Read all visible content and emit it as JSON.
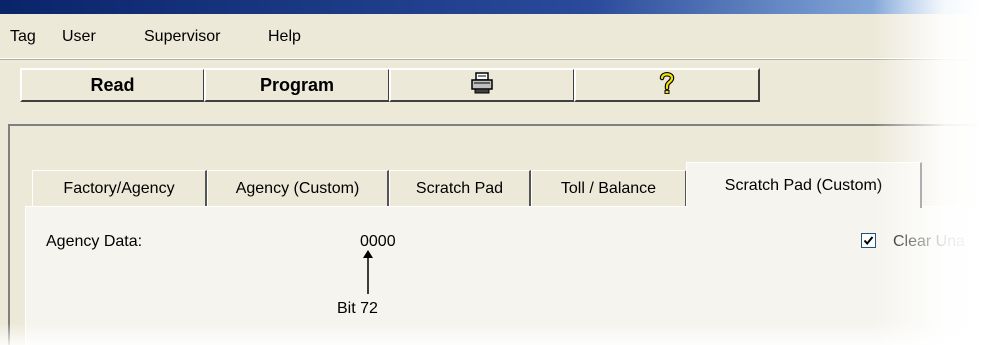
{
  "menubar": {
    "items": [
      "Tag",
      "User",
      "Supervisor",
      "Help"
    ]
  },
  "toolbar": {
    "read_label": "Read",
    "program_label": "Program",
    "print_icon": "printer-icon",
    "help_icon": "question-mark-icon"
  },
  "tabs": [
    {
      "label": "Factory/Agency",
      "active": false
    },
    {
      "label": "Agency (Custom)",
      "active": false
    },
    {
      "label": "Scratch Pad",
      "active": false
    },
    {
      "label": "Toll / Balance",
      "active": false
    },
    {
      "label": "Scratch Pad (Custom)",
      "active": true
    }
  ],
  "content": {
    "agency_data_label": "Agency Data:",
    "agency_data_value": "0000",
    "bit_label": "Bit 72",
    "checkbox_label": "Clear Una",
    "checkbox_checked": true
  },
  "colors": {
    "title_bar": "#0a246a",
    "face": "#ece9d8",
    "tab_face": "#f5f4ee"
  }
}
